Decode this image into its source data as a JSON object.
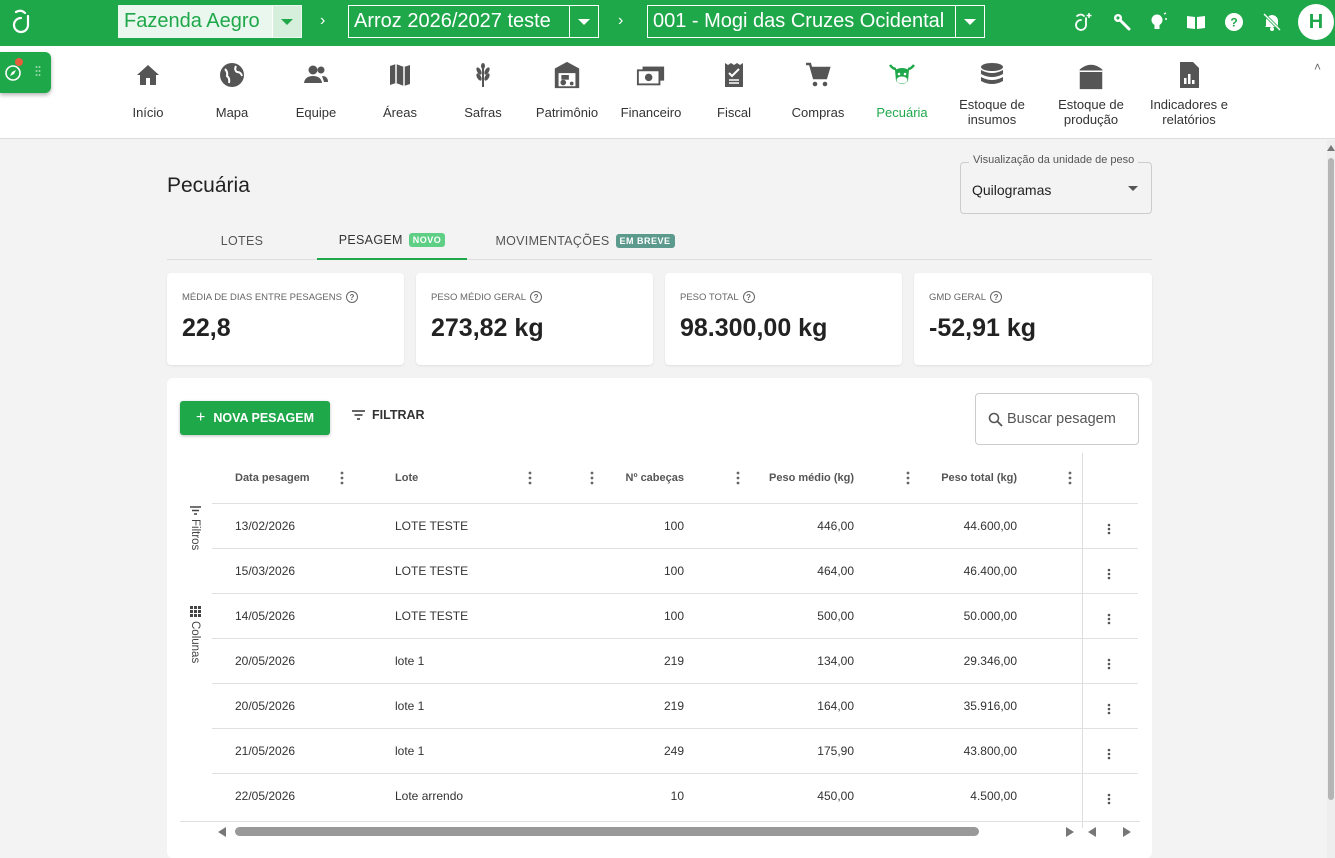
{
  "topbar": {
    "farm": "Fazenda Aegro",
    "harvest": "Arroz 2026/2027 teste",
    "field": "001 - Mogi das Cruzes Ocidental",
    "avatar_initial": "H",
    "accent": "#1fa84a"
  },
  "nav": {
    "items": [
      {
        "label": "Início",
        "icon": "home-icon"
      },
      {
        "label": "Mapa",
        "icon": "globe-icon"
      },
      {
        "label": "Equipe",
        "icon": "team-icon"
      },
      {
        "label": "Áreas",
        "icon": "map-icon"
      },
      {
        "label": "Safras",
        "icon": "grain-icon"
      },
      {
        "label": "Patrimônio",
        "icon": "tractor-icon"
      },
      {
        "label": "Financeiro",
        "icon": "money-icon"
      },
      {
        "label": "Fiscal",
        "icon": "invoice-icon"
      },
      {
        "label": "Compras",
        "icon": "cart-icon"
      },
      {
        "label": "Pecuária",
        "icon": "cow-icon"
      },
      {
        "label": "Estoque de insumos",
        "icon": "database-icon"
      },
      {
        "label": "Estoque de produção",
        "icon": "silo-icon"
      },
      {
        "label": "Indicadores e relatórios",
        "icon": "report-icon"
      }
    ]
  },
  "page": {
    "title": "Pecuária",
    "unit_legend": "Visualização da unidade de peso",
    "unit_value": "Quilogramas"
  },
  "tabs": [
    {
      "label": "LOTES",
      "badge": ""
    },
    {
      "label": "PESAGEM",
      "badge": "NOVO"
    },
    {
      "label": "MOVIMENTAÇÕES",
      "badge": "EM BREVE"
    }
  ],
  "stats": [
    {
      "label": "MÉDIA DE DIAS ENTRE PESAGENS",
      "value": "22,8"
    },
    {
      "label": "PESO MÉDIO GERAL",
      "value": "273,82 kg"
    },
    {
      "label": "PESO TOTAL",
      "value": "98.300,00 kg"
    },
    {
      "label": "GMD GERAL",
      "value": "-52,91 kg"
    }
  ],
  "toolbar": {
    "new_label": "NOVA PESAGEM",
    "filter_label": "FILTRAR",
    "search_placeholder": "Buscar pesagem"
  },
  "side_tools": {
    "filters": "Filtros",
    "columns": "Colunas"
  },
  "table": {
    "columns": [
      "Data pesagem",
      "Lote",
      "Nº cabeças",
      "Peso médio (kg)",
      "Peso total (kg)"
    ],
    "rows": [
      [
        "13/02/2026",
        "LOTE TESTE",
        "100",
        "446,00",
        "44.600,00"
      ],
      [
        "15/03/2026",
        "LOTE TESTE",
        "100",
        "464,00",
        "46.400,00"
      ],
      [
        "14/05/2026",
        "LOTE TESTE",
        "100",
        "500,00",
        "50.000,00"
      ],
      [
        "20/05/2026",
        "lote 1",
        "219",
        "134,00",
        "29.346,00"
      ],
      [
        "20/05/2026",
        "lote 1",
        "219",
        "164,00",
        "35.916,00"
      ],
      [
        "21/05/2026",
        "lote 1",
        "249",
        "175,90",
        "43.800,00"
      ],
      [
        "22/05/2026",
        "Lote arrendo",
        "10",
        "450,00",
        "4.500,00"
      ]
    ]
  }
}
